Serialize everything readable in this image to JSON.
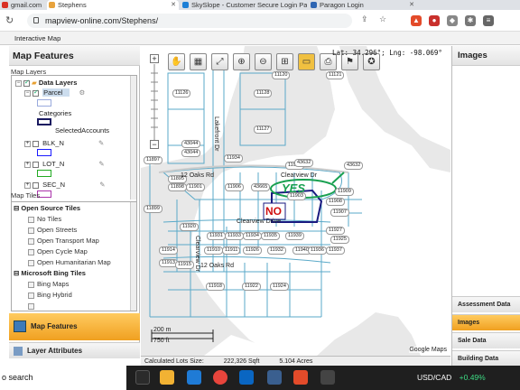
{
  "browser": {
    "tabs": [
      {
        "label": "gmail.com",
        "favicon_color": "#d93025"
      },
      {
        "label": "Stephens",
        "favicon_color": "#e8a33d",
        "active": true
      },
      {
        "label": "SkySlope - Customer Secure Login Pa",
        "favicon_color": "#1d7fd6"
      },
      {
        "label": "Paragon Login",
        "favicon_color": "#2f66b3"
      }
    ],
    "url": "mapview-online.com/Stephens/",
    "close_glyph": "✕"
  },
  "app": {
    "menu_label": "Interactive Map"
  },
  "left_panel": {
    "title": "Map Features",
    "map_layers_label": "Map Layers",
    "data_layers_label": "Data Layers",
    "parcel_label": "Parcel",
    "categories_label": "Categories",
    "selected_accounts_label": "SelectedAccounts",
    "layers": [
      {
        "label": "BLK_N",
        "color": "#1a1aff"
      },
      {
        "label": "LOT_N",
        "color": "#22aa22"
      },
      {
        "label": "SEC_N",
        "color": "#aa33aa"
      }
    ],
    "map_tiles_label": "Map Tiles",
    "open_source_label": "Open Source Tiles",
    "open_source_tiles": [
      "No Tiles",
      "Open Streets",
      "Open Transport Map",
      "Open Cycle Map",
      "Open Humanitarian Map"
    ],
    "bing_label": "Microsoft Bing Tiles",
    "bing_tiles": [
      "Bing Maps",
      "Bing Hybrid"
    ],
    "map_features_button": "Map Features",
    "layer_attributes_button": "Layer Attributes"
  },
  "map": {
    "coords_text": "Lat: 34.296°; Lng: -98.069°",
    "google_credit": "Google Maps",
    "scale_m": "200 m",
    "scale_ft": "750 ft",
    "streets": [
      "Lakefront Dr",
      "12 Oaks Rd",
      "Clearview Dr",
      "Clearview Drive",
      "Clearview Dr",
      "12 Oaks Rd"
    ],
    "annotation_yes": "YES",
    "annotation_no": "NO",
    "lot_labels": [
      "11120",
      "11121",
      "11126",
      "11128",
      "11127",
      "43044",
      "43044",
      "11897",
      "11895",
      "11905",
      "11898",
      "11901",
      "11906",
      "43665",
      "11903",
      "11909",
      "11908",
      "11907",
      "11899",
      "11920",
      "11927",
      "11931",
      "11933",
      "11934",
      "11935",
      "11939",
      "11914",
      "11910",
      "11911",
      "11926",
      "11932",
      "11940",
      "11936",
      "11937",
      "11925",
      "11913",
      "11915",
      "11918",
      "11922",
      "11924",
      "43632",
      "11934",
      "43632"
    ]
  },
  "status": {
    "calc_label": "Calculated Lots Size:",
    "sqft": "222,326 Sqft",
    "acres": "5.104 Acres"
  },
  "right_panel": {
    "title": "Images",
    "buttons": [
      "Assessment Data",
      "Images",
      "Sale Data",
      "Building Data"
    ],
    "active_button": "Images"
  },
  "taskbar": {
    "search_label": "o search",
    "currency": "USD/CAD",
    "change": "+0.49%",
    "change_color": "#3ddc84"
  }
}
